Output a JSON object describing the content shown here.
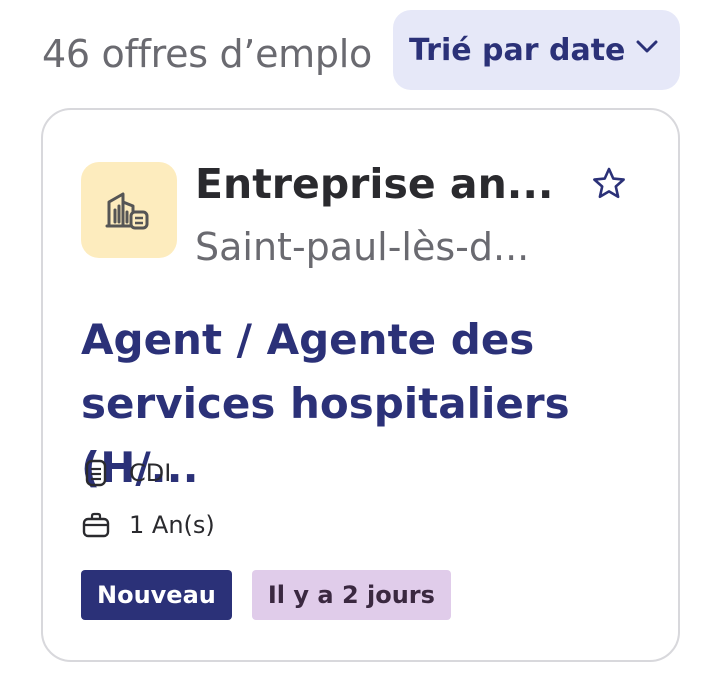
{
  "results": {
    "count_text": "46 offres d’emplo",
    "sort_label": "Trié par date"
  },
  "job_card": {
    "company": "Entreprise an...",
    "location": "Saint-paul-lès-d...",
    "title_line1": "Agent / Agente des",
    "title_line2": "services hospitaliers (H/...",
    "contract": "CDI",
    "experience": "1 An(s)",
    "badge_new": "Nouveau",
    "badge_age": "Il y a 2 jours"
  },
  "icons": {
    "sort": "chevron-down-icon",
    "logo": "building-chart-icon",
    "favorite": "star-icon",
    "contract": "document-icon",
    "experience": "briefcase-icon"
  },
  "colors": {
    "primary": "#2b3178",
    "sort_bg": "#e6e8f8",
    "logo_bg": "#fdecbe",
    "badge_age_bg": "#e0ccea"
  }
}
